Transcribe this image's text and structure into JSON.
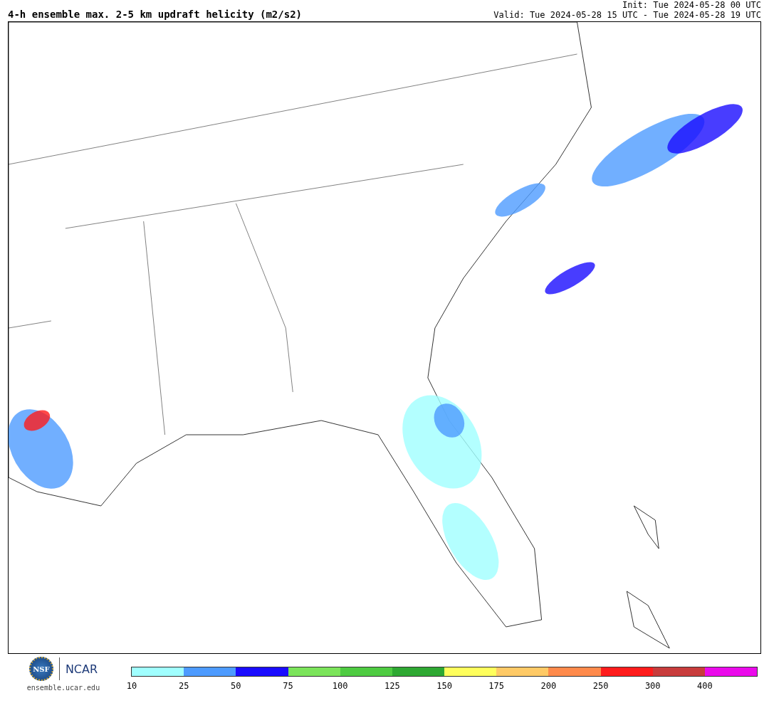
{
  "title": "4-h ensemble max. 2-5 km updraft helicity (m2/s2)",
  "init": "Init: Tue 2024-05-28 00 UTC",
  "valid": "Valid: Tue 2024-05-28 15 UTC - Tue 2024-05-28 19 UTC",
  "logos": {
    "nsf": "NSF",
    "ncar": "NCAR",
    "site": "ensemble.ucar.edu"
  },
  "legend": [
    {
      "label": "10",
      "color": "#a0ffff"
    },
    {
      "label": "25",
      "color": "#4d9bff"
    },
    {
      "label": "50",
      "color": "#1a0cff"
    },
    {
      "label": "75",
      "color": "#7be45a"
    },
    {
      "label": "100",
      "color": "#4ecb41"
    },
    {
      "label": "125",
      "color": "#2ea832"
    },
    {
      "label": "150",
      "color": "#ffff5c"
    },
    {
      "label": "175",
      "color": "#ffca66"
    },
    {
      "label": "200",
      "color": "#ff8a4b"
    },
    {
      "label": "250",
      "color": "#ff1c1c"
    },
    {
      "label": "300",
      "color": "#c83c3c"
    },
    {
      "label": "400",
      "color": "#eb0aeb"
    }
  ]
}
